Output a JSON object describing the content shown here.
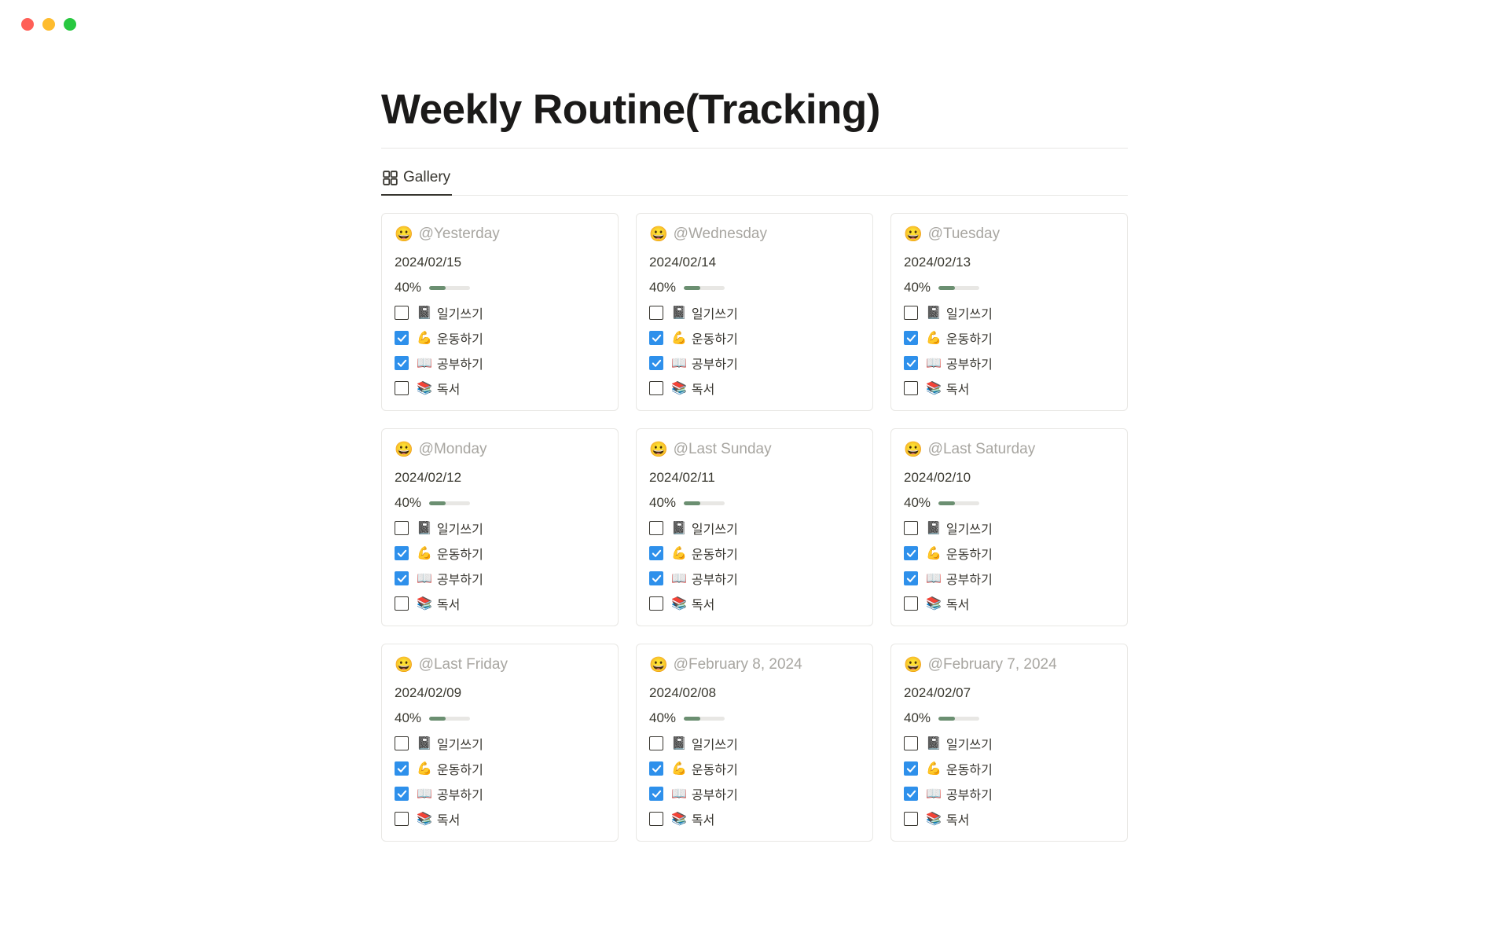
{
  "page": {
    "title": "Weekly Routine(Tracking)"
  },
  "view": {
    "tab_label": "Gallery"
  },
  "task_templates": [
    {
      "emoji": "📓",
      "text": "일기쓰기"
    },
    {
      "emoji": "💪",
      "text": "운동하기"
    },
    {
      "emoji": "📖",
      "text": "공부하기"
    },
    {
      "emoji": "📚",
      "text": "독서"
    }
  ],
  "cards": [
    {
      "emoji": "😀",
      "title": "@Yesterday",
      "date": "2024/02/15",
      "percent": "40%",
      "fill": 40,
      "checked": [
        false,
        true,
        true,
        false
      ]
    },
    {
      "emoji": "😀",
      "title": "@Wednesday",
      "date": "2024/02/14",
      "percent": "40%",
      "fill": 40,
      "checked": [
        false,
        true,
        true,
        false
      ]
    },
    {
      "emoji": "😀",
      "title": "@Tuesday",
      "date": "2024/02/13",
      "percent": "40%",
      "fill": 40,
      "checked": [
        false,
        true,
        true,
        false
      ]
    },
    {
      "emoji": "😀",
      "title": "@Monday",
      "date": "2024/02/12",
      "percent": "40%",
      "fill": 40,
      "checked": [
        false,
        true,
        true,
        false
      ]
    },
    {
      "emoji": "😀",
      "title": "@Last Sunday",
      "date": "2024/02/11",
      "percent": "40%",
      "fill": 40,
      "checked": [
        false,
        true,
        true,
        false
      ]
    },
    {
      "emoji": "😀",
      "title": "@Last Saturday",
      "date": "2024/02/10",
      "percent": "40%",
      "fill": 40,
      "checked": [
        false,
        true,
        true,
        false
      ]
    },
    {
      "emoji": "😀",
      "title": "@Last Friday",
      "date": "2024/02/09",
      "percent": "40%",
      "fill": 40,
      "checked": [
        false,
        true,
        true,
        false
      ]
    },
    {
      "emoji": "😀",
      "title": "@February 8, 2024",
      "date": "2024/02/08",
      "percent": "40%",
      "fill": 40,
      "checked": [
        false,
        true,
        true,
        false
      ]
    },
    {
      "emoji": "😀",
      "title": "@February 7, 2024",
      "date": "2024/02/07",
      "percent": "40%",
      "fill": 40,
      "checked": [
        false,
        true,
        true,
        false
      ]
    }
  ]
}
